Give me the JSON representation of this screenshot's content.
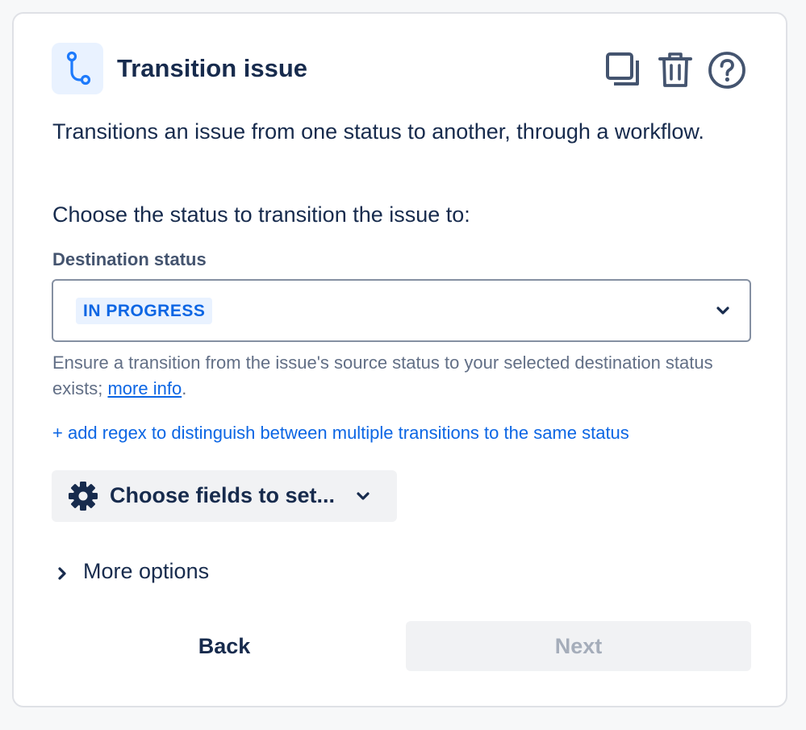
{
  "header": {
    "title": "Transition issue",
    "icon": "transition-path-icon",
    "actions": [
      {
        "name": "copy-button",
        "icon": "copy-icon"
      },
      {
        "name": "delete-button",
        "icon": "trash-icon"
      },
      {
        "name": "help-button",
        "icon": "help-icon"
      }
    ]
  },
  "description": "Transitions an issue from one status to another, through a workflow.",
  "prompt": "Choose the status to transition the issue to:",
  "destination": {
    "label": "Destination status",
    "selected": "IN PROGRESS",
    "helper_text": "Ensure a transition from the issue's source status to your selected destination status exists; ",
    "helper_link": "more info",
    "helper_end": "."
  },
  "regex_link": "+ add regex to distinguish between multiple transitions to the same status",
  "fields_button": {
    "label": "Choose fields to set...",
    "icon": "gear-icon"
  },
  "more_options": {
    "label": "More options",
    "icon": "chevron-right-icon"
  },
  "footer": {
    "back_label": "Back",
    "next_label": "Next",
    "next_disabled": true
  },
  "colors": {
    "primary_text": "#172b4d",
    "link": "#0c66e4",
    "lozenge_bg": "#e9f2ff",
    "muted": "#626f86",
    "disabled_text": "#a5adba"
  }
}
